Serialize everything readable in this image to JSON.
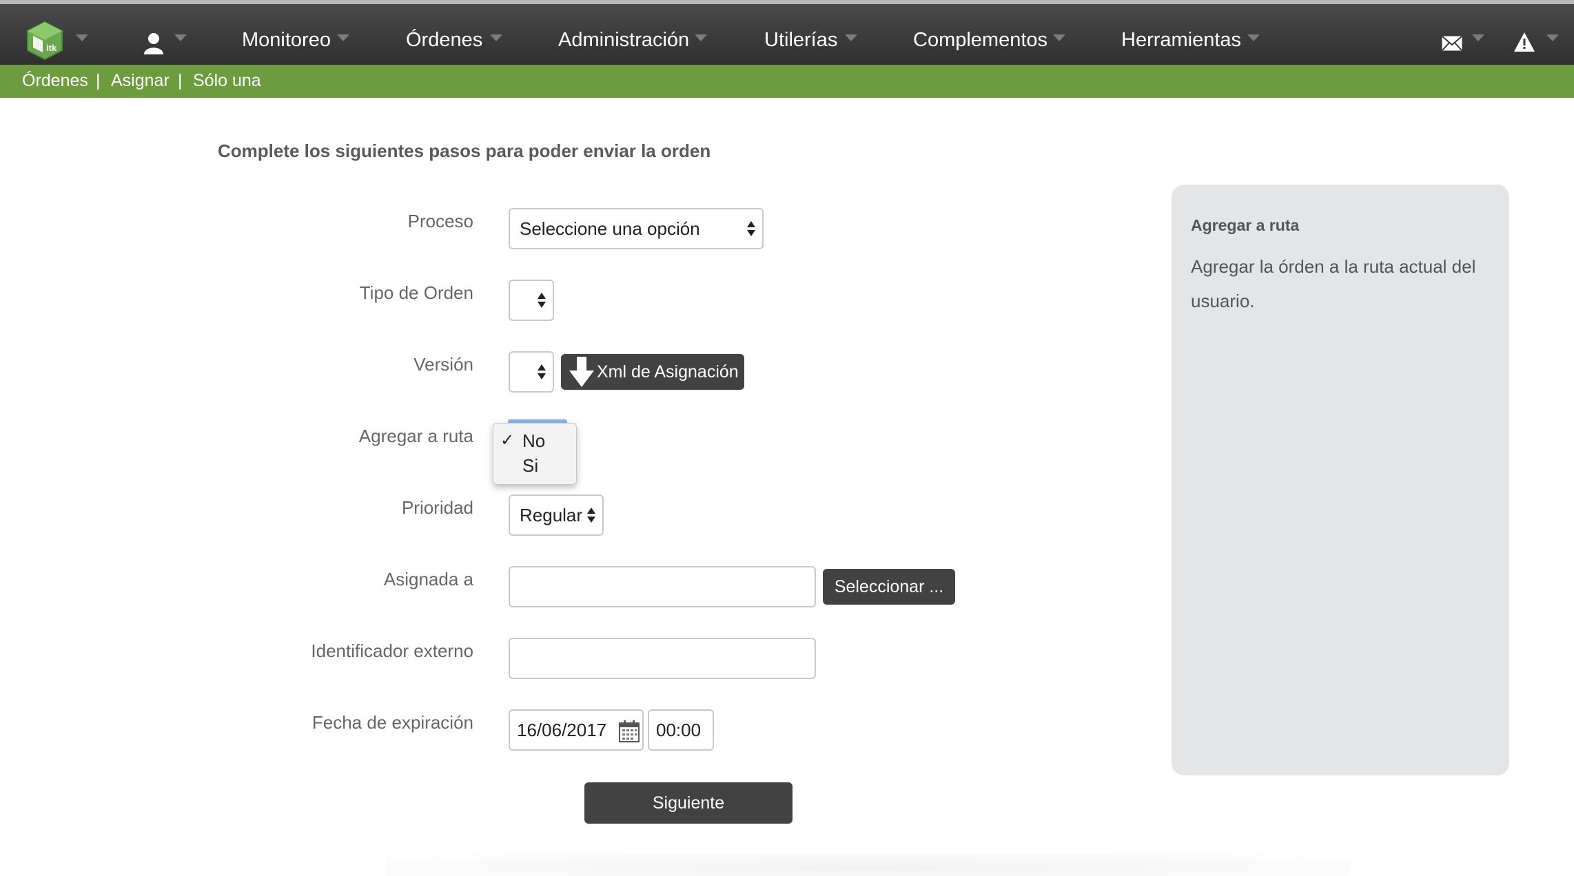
{
  "topbar": {
    "nav": [
      "Monitoreo",
      "Órdenes",
      "Administración",
      "Utilerías",
      "Complementos",
      "Herramientas"
    ],
    "logo_icon": "app-logo-cube",
    "user_icon": "user-icon",
    "mail_icon": "mail-icon",
    "alert_icon": "warning-icon"
  },
  "breadcrumb": {
    "items": [
      "Órdenes",
      "Asignar",
      "Sólo una"
    ],
    "separator": "|"
  },
  "form": {
    "heading": "Complete los siguientes pasos para poder enviar la orden",
    "proceso": {
      "label": "Proceso",
      "value": "Seleccione una opción"
    },
    "tipo_orden": {
      "label": "Tipo de Orden",
      "value": ""
    },
    "version": {
      "label": "Versión",
      "value": "",
      "xml_button": "Xml de Asignación"
    },
    "agregar_ruta": {
      "label": "Agregar a ruta",
      "options": [
        "No",
        "Si"
      ],
      "selected": "No",
      "check": "✓"
    },
    "prioridad": {
      "label": "Prioridad",
      "value": "Regular"
    },
    "asignada": {
      "label": "Asignada a",
      "value": "",
      "button": "Seleccionar ..."
    },
    "identificador": {
      "label": "Identificador externo",
      "value": ""
    },
    "fecha": {
      "label": "Fecha de expiración",
      "date": "16/06/2017",
      "time": "00:00"
    },
    "submit": "Siguiente"
  },
  "help": {
    "title": "Agregar a ruta",
    "text": "Agregar la órden a la ruta actual del usuario."
  },
  "colors": {
    "topbar": "#3a3a3a",
    "breadcrumb_bar": "#6b9c3d",
    "button_dark": "#424242",
    "panel": "#e4e5e6"
  }
}
